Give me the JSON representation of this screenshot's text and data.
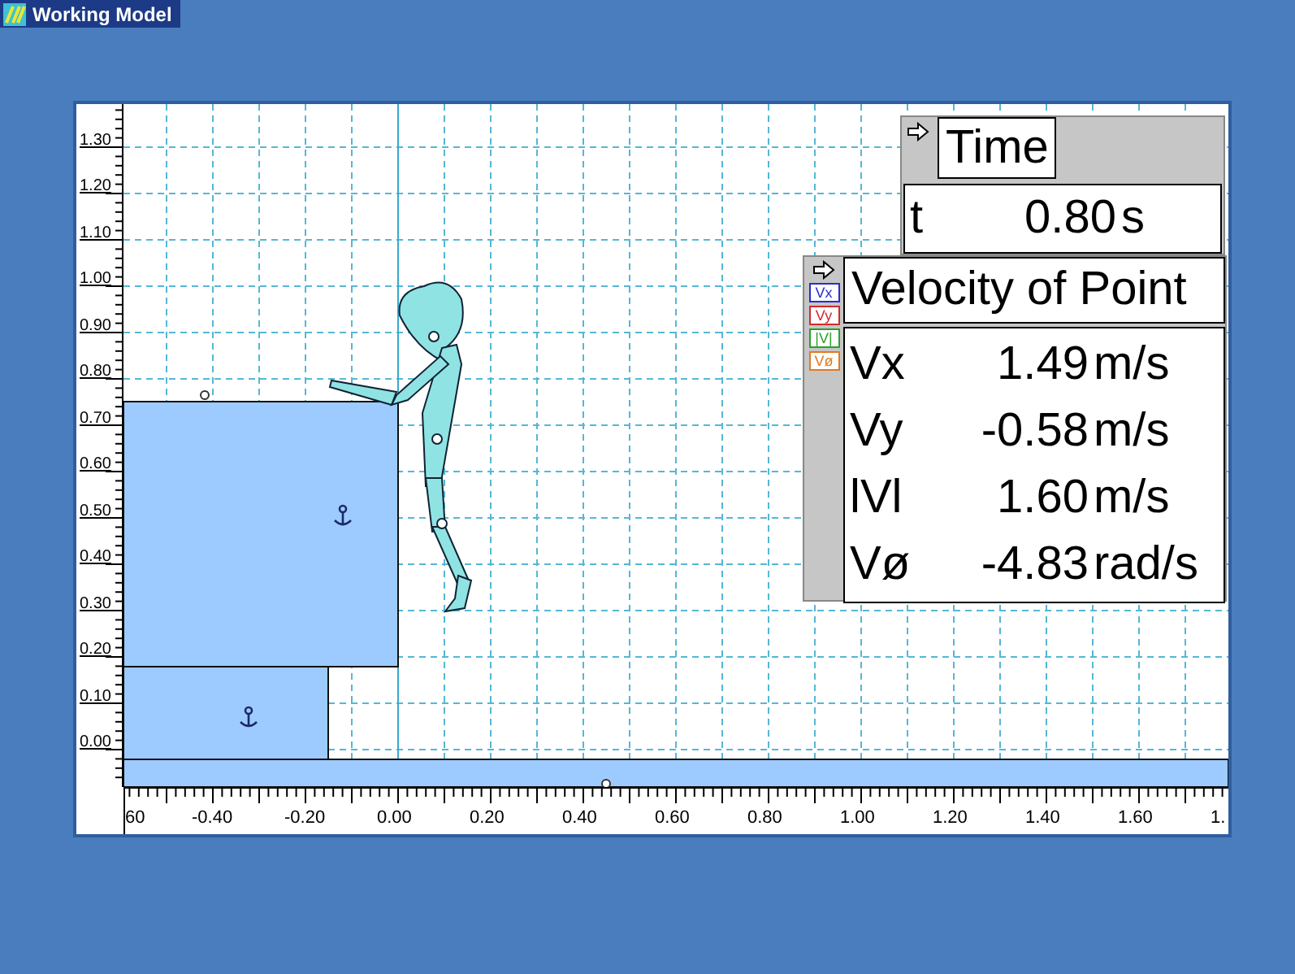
{
  "window": {
    "title": "Working Model"
  },
  "y_ruler": {
    "labels": [
      "1.30",
      "1.20",
      "1.10",
      "1.00",
      "0.90",
      "0.80",
      "0.70",
      "0.60",
      "0.50",
      "0.40",
      "0.30",
      "0.20",
      "0.10",
      "0.00"
    ]
  },
  "x_ruler": {
    "labels": [
      "60",
      "-0.40",
      "-0.20",
      "0.00",
      "0.20",
      "0.40",
      "0.60",
      "0.80",
      "1.00",
      "1.20",
      "1.40",
      "1.60",
      "1."
    ]
  },
  "meters": [
    {
      "kind": "time",
      "title": "Time",
      "rows": [
        {
          "label": "t",
          "value": "0.80",
          "unit": "s"
        }
      ]
    },
    {
      "kind": "velocity",
      "title": "Velocity of Point",
      "legend": [
        {
          "label": "Vx",
          "color": "#2b2bd0"
        },
        {
          "label": "Vy",
          "color": "#d02b2b"
        },
        {
          "label": "|V|",
          "color": "#2ba02b"
        },
        {
          "label": "Vø",
          "color": "#e07a20"
        }
      ],
      "rows": [
        {
          "label": "Vx",
          "value": "1.49",
          "unit": "m/s"
        },
        {
          "label": "Vy",
          "value": "-0.58",
          "unit": "m/s"
        },
        {
          "label": "lVl",
          "value": "1.60",
          "unit": "m/s"
        },
        {
          "label": "Vø",
          "value": "-4.83",
          "unit": "rad/s"
        }
      ]
    }
  ]
}
